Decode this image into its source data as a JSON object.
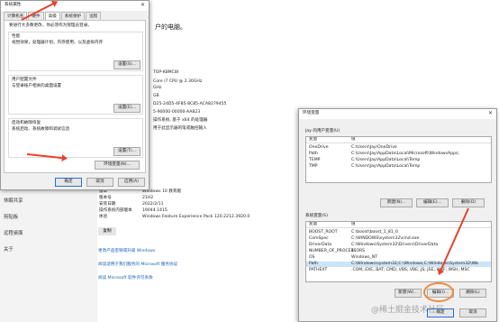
{
  "sysprop": {
    "title": "系统属性",
    "tabs": [
      "计算机名",
      "硬件",
      "高级",
      "系统保护",
      "远程"
    ],
    "active_tab": "高级",
    "admin_note": "要进行大多数更改，你必须作为管理员登录。",
    "performance": {
      "title": "性能",
      "desc": "视觉效果，处理器计划，内存使用，以及虚拟内存",
      "button": "设置(S)..."
    },
    "profiles": {
      "title": "用户配置文件",
      "desc": "与登录账户相关的桌面设置",
      "button": "设置(E)..."
    },
    "startup": {
      "title": "启动和故障恢复",
      "desc": "系统启动、系统故障和调试信息",
      "button": "设置(T)..."
    },
    "env_button": "环境变量(N)...",
    "ok": "确定",
    "cancel": "取消",
    "apply": "应用(A)"
  },
  "settings_page": {
    "nav": [
      "休眠共享",
      "剪贴板",
      "远程桌面",
      "关于"
    ],
    "heading_tail": "户的电脑。",
    "specs": [
      "TOP-K8MC8I",
      "Core i7 CPU @ 2.30GHz",
      "GHz",
      "GB",
      "D25-24D5-4F85-8C85-ACA8279455",
      "5-90000-00000-AA823",
      "操作系统, 基于 x64 的处理器",
      "用于此显示器的笔或触控输入"
    ],
    "copy_button": "复制",
    "windows_rows": [
      {
        "label": "版本",
        "value": "Windows 10 教育版"
      },
      {
        "label": "版本号",
        "value": "21H2"
      },
      {
        "label": "安装日期",
        "value": "2022/2/11"
      },
      {
        "label": "操作系统内部版本",
        "value": "19044.1415"
      },
      {
        "label": "体验",
        "value": "Windows Feature Experience Pack 120.2212.3920.0"
      }
    ],
    "copy_button_2": "复制",
    "links": [
      "更改产品密钥或升级 Windows",
      "阅读适用于我们服务的 Microsoft 服务协议",
      "阅读 Microsoft 软件许可条款"
    ]
  },
  "env": {
    "title": "环境变量",
    "user_section": "Jay 的用户变量(U)",
    "columns": [
      "变量",
      "值"
    ],
    "user_vars": [
      {
        "name": "OneDrive",
        "value": "C:\\Users\\Jay\\OneDrive"
      },
      {
        "name": "Path",
        "value": "C:\\Users\\Jay\\AppData\\Local\\Microsoft\\WindowsApps;"
      },
      {
        "name": "TEMP",
        "value": "C:\\Users\\Jay\\AppData\\Local\\Temp"
      },
      {
        "name": "TMP",
        "value": "C:\\Users\\Jay\\AppData\\Local\\Temp"
      }
    ],
    "user_buttons": [
      "新建(N)...",
      "编辑(E)...",
      "删除(D)"
    ],
    "system_section": "系统变量(S)",
    "sys_vars": [
      {
        "name": "BOOST_ROOT",
        "value": "C:\\boost\\boost_1_81_0"
      },
      {
        "name": "ComSpec",
        "value": "C:\\WINDOWS\\system32\\cmd.exe"
      },
      {
        "name": "DriverData",
        "value": "C:\\Windows\\System32\\Drivers\\DriverData"
      },
      {
        "name": "NUMBER_OF_PROCESSORS",
        "value": "4"
      },
      {
        "name": "OS",
        "value": "Windows_NT"
      },
      {
        "name": "Path",
        "value": "C:\\Windows\\system32;C:\\Windows;C:\\Windows\\System32\\Wb"
      },
      {
        "name": "PATHEXT",
        "value": ".COM;.EXE;.BAT;.CMD;.VBS;.VBE;.JS;.JSE;.WSF;.WSH;.MSC"
      }
    ],
    "selected_sys_row": 5,
    "sys_buttons": [
      "新建(W)...",
      "编辑(I)...",
      "删除(L)"
    ],
    "ok": "确定",
    "cancel": "取消"
  },
  "watermark": "@稀土掘金技术社区",
  "colors": {
    "arrow": "#e8412c",
    "link": "#1a5fb4",
    "selection": "#cce4f7"
  }
}
